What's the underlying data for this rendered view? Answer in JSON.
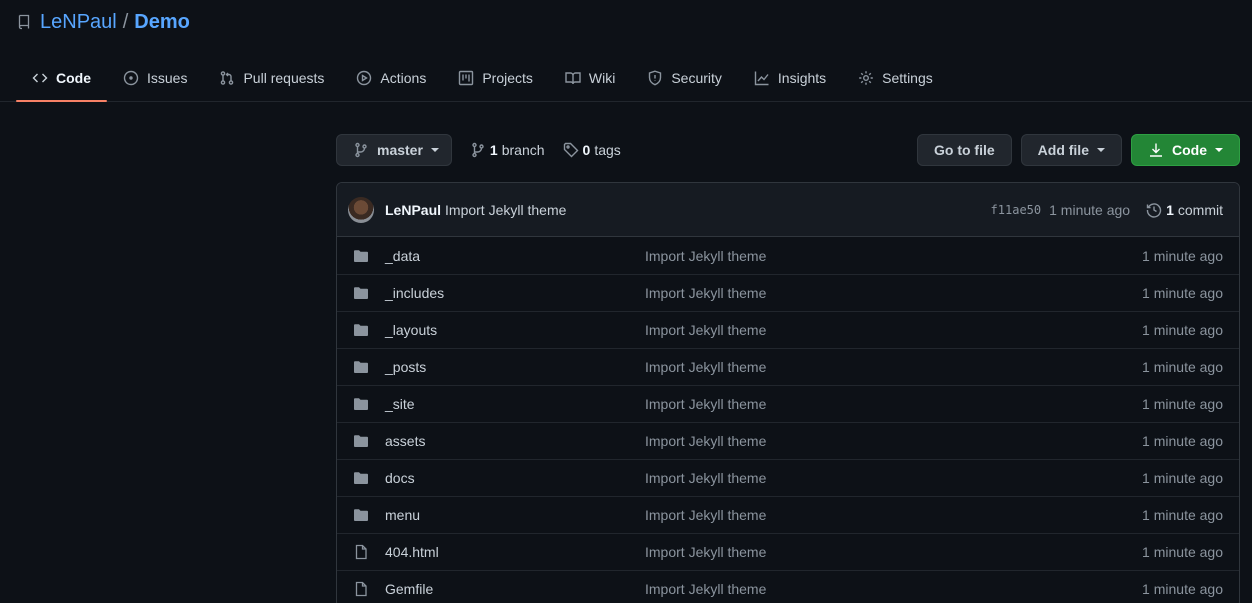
{
  "repo": {
    "owner": "LeNPaul",
    "separator": "/",
    "name": "Demo"
  },
  "tabs": [
    {
      "label": "Code",
      "icon": "code-icon",
      "active": true
    },
    {
      "label": "Issues",
      "icon": "issue-icon"
    },
    {
      "label": "Pull requests",
      "icon": "pull-request-icon"
    },
    {
      "label": "Actions",
      "icon": "play-icon"
    },
    {
      "label": "Projects",
      "icon": "project-icon"
    },
    {
      "label": "Wiki",
      "icon": "book-icon"
    },
    {
      "label": "Security",
      "icon": "shield-icon"
    },
    {
      "label": "Insights",
      "icon": "graph-icon"
    },
    {
      "label": "Settings",
      "icon": "gear-icon"
    }
  ],
  "toolbar": {
    "branch_label": "master",
    "branches_count": "1",
    "branches_label": "branch",
    "tags_count": "0",
    "tags_label": "tags",
    "go_to_file": "Go to file",
    "add_file": "Add file",
    "code": "Code"
  },
  "commit": {
    "author": "LeNPaul",
    "message": "Import Jekyll theme",
    "sha": "f11ae50",
    "time": "1 minute ago",
    "count": "1",
    "count_label": "commit"
  },
  "files": [
    {
      "name": "_data",
      "type": "dir",
      "message": "Import Jekyll theme",
      "age": "1 minute ago"
    },
    {
      "name": "_includes",
      "type": "dir",
      "message": "Import Jekyll theme",
      "age": "1 minute ago"
    },
    {
      "name": "_layouts",
      "type": "dir",
      "message": "Import Jekyll theme",
      "age": "1 minute ago"
    },
    {
      "name": "_posts",
      "type": "dir",
      "message": "Import Jekyll theme",
      "age": "1 minute ago"
    },
    {
      "name": "_site",
      "type": "dir",
      "message": "Import Jekyll theme",
      "age": "1 minute ago"
    },
    {
      "name": "assets",
      "type": "dir",
      "message": "Import Jekyll theme",
      "age": "1 minute ago"
    },
    {
      "name": "docs",
      "type": "dir",
      "message": "Import Jekyll theme",
      "age": "1 minute ago"
    },
    {
      "name": "menu",
      "type": "dir",
      "message": "Import Jekyll theme",
      "age": "1 minute ago"
    },
    {
      "name": "404.html",
      "type": "file",
      "message": "Import Jekyll theme",
      "age": "1 minute ago"
    },
    {
      "name": "Gemfile",
      "type": "file",
      "message": "Import Jekyll theme",
      "age": "1 minute ago"
    }
  ],
  "colors": {
    "background": "#0d1117",
    "link": "#58a6ff",
    "active_tab_underline": "#f78166",
    "primary_button": "#238636"
  }
}
